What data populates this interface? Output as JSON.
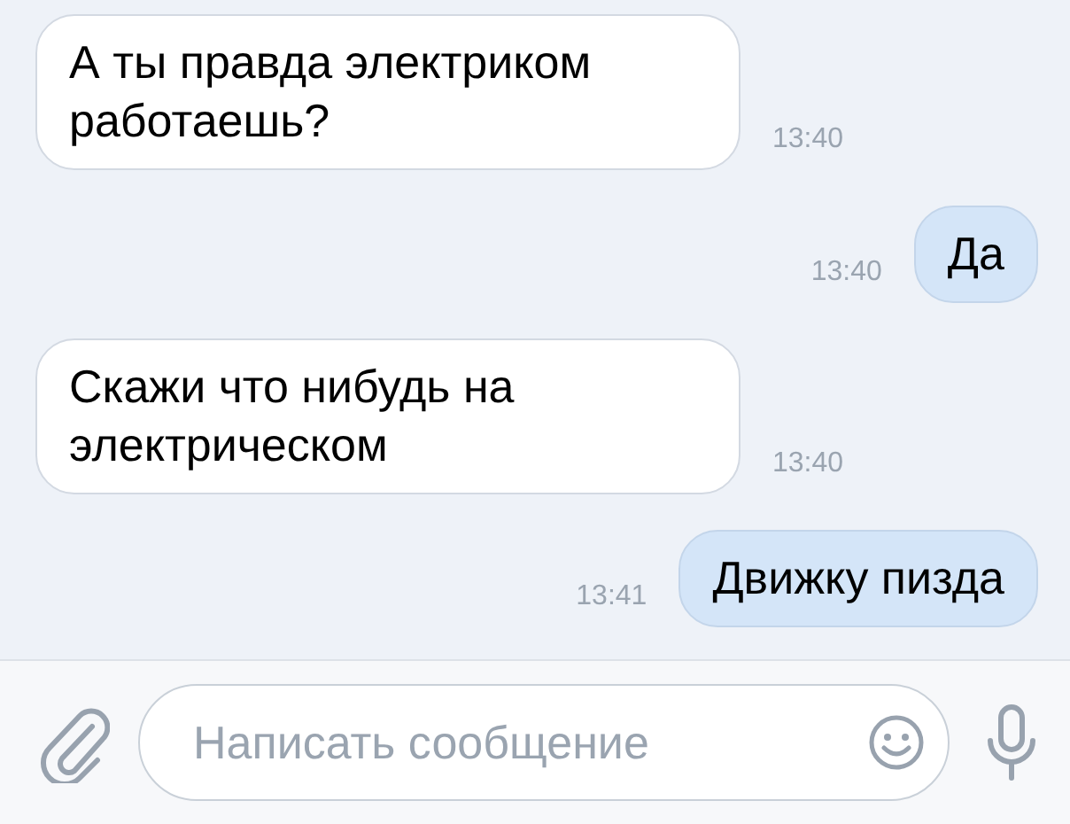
{
  "messages": [
    {
      "text": "А ты правда электриком работаешь?",
      "time": "13:40",
      "outgoing": false
    },
    {
      "text": "Да",
      "time": "13:40",
      "outgoing": true
    },
    {
      "text": "Скажи что нибудь на электрическом",
      "time": "13:40",
      "outgoing": false
    },
    {
      "text": "Движку пизда",
      "time": "13:41",
      "outgoing": true
    }
  ],
  "composer": {
    "placeholder": "Написать сообщение"
  }
}
